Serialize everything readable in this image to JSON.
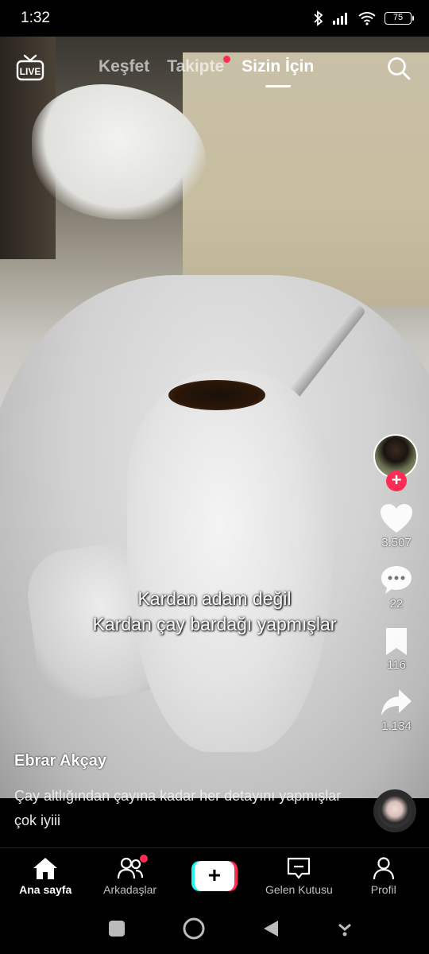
{
  "status_bar": {
    "time": "1:32",
    "battery": "75"
  },
  "top_nav": {
    "live_label": "LIVE",
    "tabs": [
      {
        "label": "Keşfet"
      },
      {
        "label": "Takipte"
      },
      {
        "label": "Sizin İçin"
      }
    ]
  },
  "video": {
    "caption_lines": [
      "Kardan adam değil",
      "Kardan çay bardağı yapmışlar"
    ]
  },
  "rail": {
    "likes": "3.507",
    "comments": "22",
    "saves": "116",
    "shares": "1.134"
  },
  "post": {
    "username": "Ebrar Akçay",
    "description": "Çay altlığından çayına kadar her detayını yapmışlar çok iyiii"
  },
  "tabbar": {
    "items": [
      {
        "label": "Ana sayfa"
      },
      {
        "label": "Arkadaşlar"
      },
      {
        "label": "+"
      },
      {
        "label": "Gelen Kutusu"
      },
      {
        "label": "Profil"
      }
    ]
  },
  "colors": {
    "accent_red": "#fe2c55",
    "accent_cyan": "#25f4ee"
  }
}
